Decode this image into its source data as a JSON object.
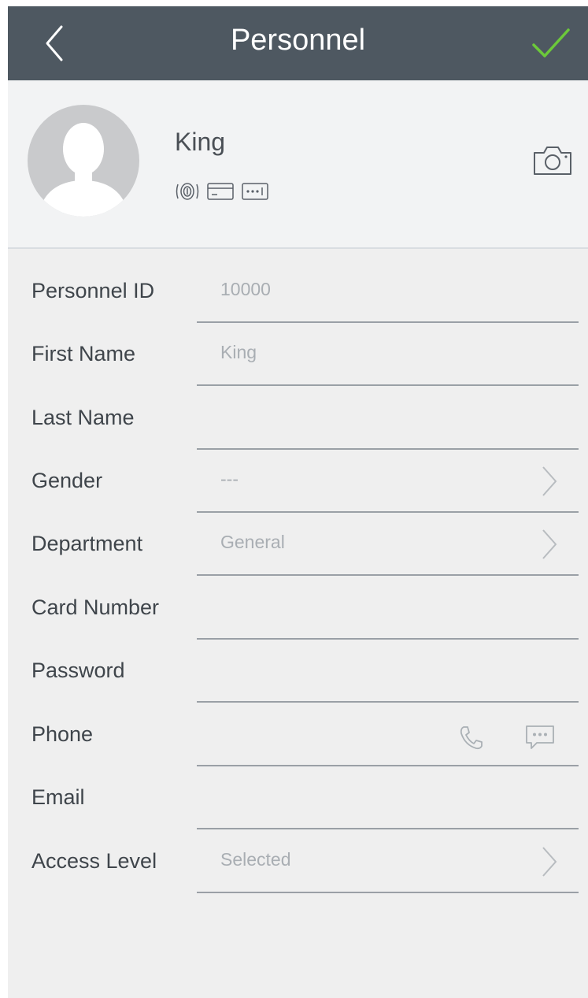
{
  "header": {
    "title": "Personnel"
  },
  "profile": {
    "name": "King"
  },
  "fields": {
    "personnel_id": {
      "label": "Personnel ID",
      "value": "10000"
    },
    "first_name": {
      "label": "First Name",
      "value": "King"
    },
    "last_name": {
      "label": "Last Name",
      "value": ""
    },
    "gender": {
      "label": "Gender",
      "value": "---"
    },
    "department": {
      "label": "Department",
      "value": "General"
    },
    "card_number": {
      "label": "Card Number",
      "value": ""
    },
    "password": {
      "label": "Password",
      "value": ""
    },
    "phone": {
      "label": "Phone",
      "value": ""
    },
    "email": {
      "label": "Email",
      "value": ""
    },
    "access_level": {
      "label": "Access Level",
      "value": "Selected"
    }
  },
  "colors": {
    "header_bg": "#4e5861",
    "accent_check": "#6cc93a",
    "label_text": "#3f454b",
    "value_text": "#a9aeb3"
  },
  "icons": [
    "back-arrow-icon",
    "checkmark-icon",
    "fingerprint-icon",
    "card-icon",
    "password-icon",
    "camera-icon",
    "chevron-right-icon",
    "phone-icon",
    "message-icon"
  ]
}
